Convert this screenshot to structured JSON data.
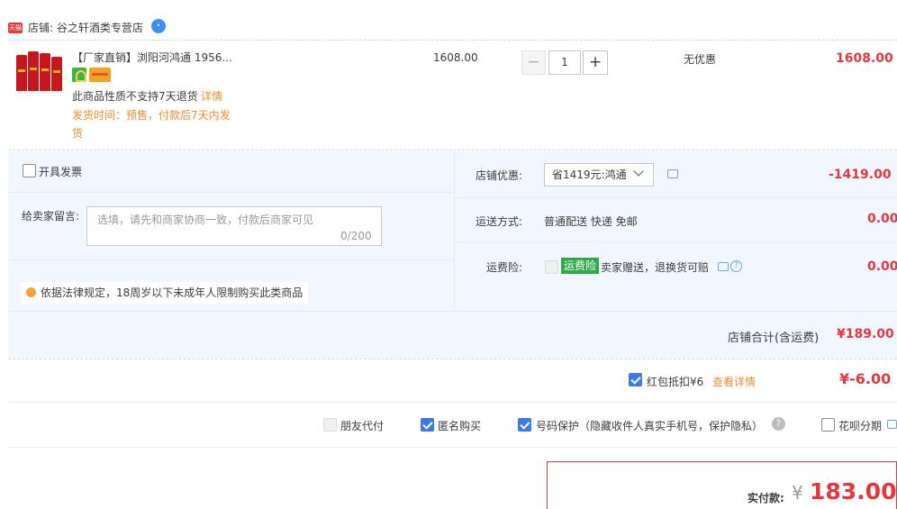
{
  "shop": {
    "badge": "天猫",
    "name": "店铺: 谷之轩酒类专营店",
    "ww_badge": "•"
  },
  "item": {
    "title": "【厂家直销】浏阳河鸿通 1956...",
    "no_return": "此商品性质不支持7天退货",
    "detail_link": "详情",
    "ship_time": "发货时间：预售，付款后7天内发货",
    "unit_price": "1608.00",
    "qty_minus": "−",
    "qty": "1",
    "qty_plus": "+",
    "discount": "无优惠",
    "total": "1608.00"
  },
  "options": {
    "invoice_label": "开具发票",
    "message_label": "给卖家留言:",
    "message_placeholder": "选填，请先和商家协商一致，付款后商家可见",
    "message_count": "0/200",
    "legal_tip": "依据法律规定，18周岁以下未成年人限制购买此类商品"
  },
  "summary": {
    "shop_discount_label": "店铺优惠:",
    "shop_discount_select": "省1419元:鸿通",
    "shop_discount_amount": "-1419.00",
    "delivery_label": "运送方式:",
    "delivery_value": "普通配送 快递 免邮",
    "delivery_amount": "0.00",
    "insurance_label": "运费险:",
    "insurance_tag": "运费险",
    "insurance_desc": "卖家赠送，退换货可赔",
    "insurance_amount": "0.00",
    "shop_total_label": "店铺合计(含运费)",
    "shop_total_amount": "¥189.00"
  },
  "red_packet": {
    "label": "红包抵扣¥6",
    "view_detail": "查看详情",
    "amount": "¥-6.00"
  },
  "extras": {
    "friend_pay": "朋友代付",
    "anonymous": "匿名购买",
    "number_protect": "号码保护（隐藏收件人真实手机号，保护隐私）",
    "help": "?",
    "huabei": "花呗分期"
  },
  "payment": {
    "label": "实付款:",
    "currency": "¥",
    "amount": "183.00"
  },
  "colors": {
    "accent_red": "#e4393c",
    "accent_orange": "#ef8e30",
    "check_blue": "#3c7be6",
    "panel_bg": "#f2f7ff"
  }
}
